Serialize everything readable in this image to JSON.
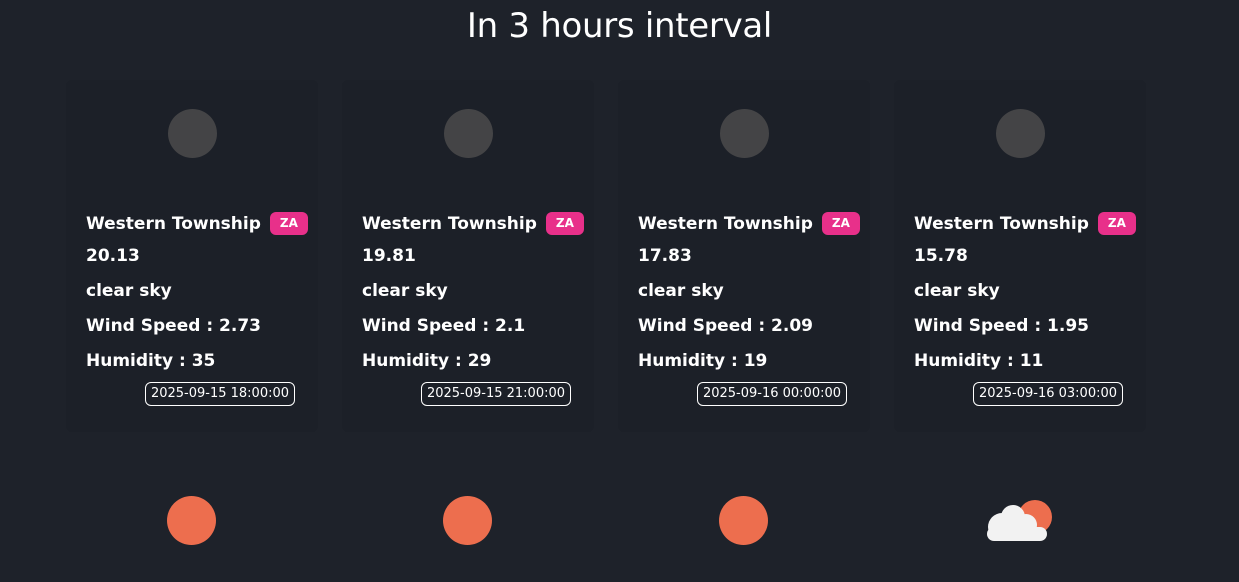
{
  "page": {
    "title": "In 3 hours interval"
  },
  "colors": {
    "background": "#1e222a",
    "badge": "#e8308a",
    "moon_icon": "#444446",
    "sun_icon": "#ed6e4e",
    "cloud_icon": "#f2f2f2"
  },
  "forecast": [
    {
      "city": "Western Township",
      "country": "ZA",
      "temp": "20.13",
      "description": "clear sky",
      "wind": "Wind Speed : 2.73",
      "humidity": "Humidity : 35",
      "time": "2025-09-15 18:00:00",
      "icon": "moon-icon"
    },
    {
      "city": "Western Township",
      "country": "ZA",
      "temp": "19.81",
      "description": "clear sky",
      "wind": "Wind Speed : 2.1",
      "humidity": "Humidity : 29",
      "time": "2025-09-15 21:00:00",
      "icon": "moon-icon"
    },
    {
      "city": "Western Township",
      "country": "ZA",
      "temp": "17.83",
      "description": "clear sky",
      "wind": "Wind Speed : 2.09",
      "humidity": "Humidity : 19",
      "time": "2025-09-16 00:00:00",
      "icon": "moon-icon"
    },
    {
      "city": "Western Township",
      "country": "ZA",
      "temp": "15.78",
      "description": "clear sky",
      "wind": "Wind Speed : 1.95",
      "humidity": "Humidity : 11",
      "time": "2025-09-16 03:00:00",
      "icon": "moon-icon"
    }
  ],
  "next_row_icons": [
    "sun-icon",
    "sun-icon",
    "sun-icon",
    "sun-cloud-icon"
  ]
}
